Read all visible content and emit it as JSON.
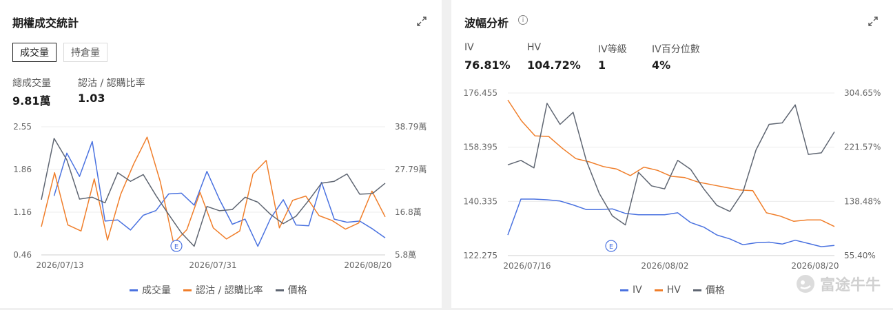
{
  "colors": {
    "blue": "#4a72e0",
    "orange": "#f07e2a",
    "gray": "#5f6672"
  },
  "left_panel": {
    "title": "期權成交統計",
    "tabs": [
      "成交量",
      "持倉量"
    ],
    "stats": [
      {
        "label": "總成交量",
        "value": "9.81萬"
      },
      {
        "label": "認沽 / 認購比率",
        "value": "1.03"
      }
    ],
    "legend": [
      "成交量",
      "認沽 / 認購比率",
      "價格"
    ],
    "event_marker": "E"
  },
  "right_panel": {
    "title": "波幅分析",
    "stats": [
      {
        "label": "IV",
        "value": "76.81%"
      },
      {
        "label": "HV",
        "value": "104.72%"
      },
      {
        "label": "IV等級",
        "value": "1"
      },
      {
        "label": "IV百分位數",
        "value": "4%"
      }
    ],
    "legend": [
      "IV",
      "HV",
      "價格"
    ],
    "event_marker": "E"
  },
  "watermark": "富途牛牛",
  "chart_data": [
    {
      "type": "line",
      "x_ticks": [
        "2026/07/13",
        "2026/07/31",
        "2026/08/20"
      ],
      "y_left_ticks": [
        "2.55",
        "1.86",
        "1.16",
        "0.46"
      ],
      "y_left_range": [
        0.46,
        2.55
      ],
      "y_right_ticks": [
        "38.79萬",
        "27.79萬",
        "16.8萬",
        "5.8萬"
      ],
      "y_right_range": [
        5.8,
        38.79
      ],
      "grid": true,
      "legend_position": "bottom",
      "series": [
        {
          "name": "成交量",
          "axis": "right",
          "color": "#4a72e0",
          "values": [
            null,
            21.0,
            32.0,
            26.0,
            35.0,
            14.5,
            14.8,
            12.2,
            16.0,
            17.2,
            21.5,
            21.7,
            18.6,
            27.3,
            20.0,
            13.7,
            15.0,
            8.0,
            15.2,
            20.0,
            13.5,
            13.3,
            24.5,
            15.0,
            14.2,
            14.5,
            12.5,
            10.2
          ]
        },
        {
          "name": "認沽 / 認購比率",
          "axis": "left",
          "color": "#f07e2a",
          "values": [
            0.92,
            1.8,
            0.95,
            0.85,
            1.7,
            0.7,
            1.45,
            1.95,
            2.38,
            1.65,
            0.65,
            0.87,
            1.48,
            0.9,
            0.72,
            0.85,
            1.78,
            2.0,
            0.9,
            1.35,
            1.42,
            1.1,
            1.02,
            0.88,
            0.98,
            1.5,
            1.08
          ]
        },
        {
          "name": "價格",
          "axis": "left",
          "color": "#5f6672",
          "values": [
            1.36,
            2.36,
            2.01,
            1.37,
            1.4,
            1.31,
            1.8,
            1.66,
            1.77,
            1.43,
            1.12,
            0.82,
            0.6,
            1.25,
            1.18,
            1.2,
            1.4,
            1.32,
            1.12,
            0.97,
            1.09,
            1.35,
            1.63,
            1.66,
            1.78,
            1.45,
            1.46,
            1.63
          ]
        }
      ]
    },
    {
      "type": "line",
      "x_ticks": [
        "2026/07/16",
        "2026/08/02",
        "2026/08/20"
      ],
      "y_left_ticks": [
        "176.455",
        "158.395",
        "140.335",
        "122.275"
      ],
      "y_left_range": [
        122.275,
        176.455
      ],
      "y_right_ticks": [
        "304.65%",
        "221.57%",
        "138.48%",
        "55.40%"
      ],
      "y_right_range": [
        55.4,
        304.65
      ],
      "grid": true,
      "legend_position": "bottom",
      "series": [
        {
          "name": "IV",
          "axis": "right",
          "color": "#4a72e0",
          "values": [
            87,
            142,
            142,
            141,
            139,
            133,
            126,
            126,
            127,
            120,
            118,
            118,
            118,
            121,
            106,
            99,
            87,
            81,
            72,
            75,
            76,
            73,
            79,
            74,
            69,
            71
          ]
        },
        {
          "name": "HV",
          "axis": "right",
          "color": "#f07e2a",
          "values": [
            294,
            262,
            239,
            238,
            220,
            204,
            199,
            192,
            188,
            178,
            191,
            186,
            177,
            175,
            168,
            164,
            160,
            156,
            155,
            121,
            116,
            108,
            110,
            110,
            100
          ]
        },
        {
          "name": "價格",
          "axis": "left",
          "color": "#5f6672",
          "values": [
            152.5,
            154.0,
            151.5,
            173.0,
            166.0,
            170.0,
            154.0,
            143.0,
            135.5,
            132.5,
            150.0,
            145.5,
            144.5,
            154.0,
            151.0,
            144.5,
            139.0,
            137.0,
            143.5,
            157.5,
            166.0,
            166.5,
            172.5,
            156.0,
            156.5,
            163.5
          ]
        }
      ]
    }
  ]
}
